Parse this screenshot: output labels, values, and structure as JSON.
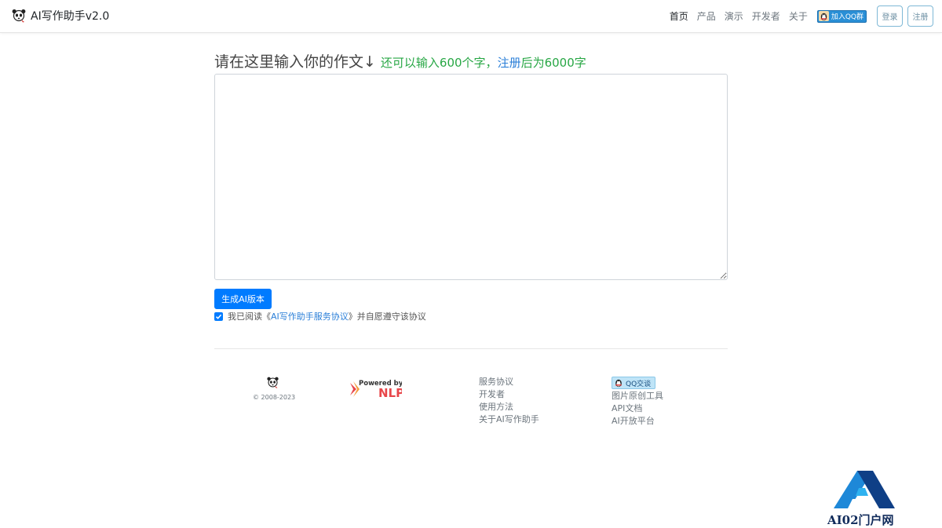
{
  "nav": {
    "brand": "AI写作助手v2.0",
    "links": [
      "首页",
      "产品",
      "演示",
      "开发者",
      "关于"
    ],
    "qq_group": "加入QQ群",
    "login": "登录",
    "register": "注册"
  },
  "main": {
    "title": "请在这里输入你的作文↓",
    "quota_prefix": "还可以输入600个字，",
    "quota_register": "注册",
    "quota_suffix": "后为6000字",
    "textarea_value": "",
    "generate_button": "生成AI版本",
    "agree_checked": true,
    "agree_prefix": "我已阅读《",
    "agree_link": "AI写作助手服务协议",
    "agree_suffix": "》并自愿遵守该协议"
  },
  "footer": {
    "copyright": "© 2008-2023",
    "powered_by": "Powered by",
    "powered_brand": "NLP",
    "col1": [
      "服务协议",
      "开发者",
      "使用方法",
      "关于AI写作助手"
    ],
    "qq_chat": "QQ交谈",
    "col2": [
      "图片原创工具",
      "API文档",
      "AI开放平台"
    ]
  },
  "watermark": {
    "text": "AI02门户网"
  },
  "colors": {
    "primary": "#007bff",
    "quota_green": "#28a745",
    "link_blue": "#2b7fd8"
  }
}
